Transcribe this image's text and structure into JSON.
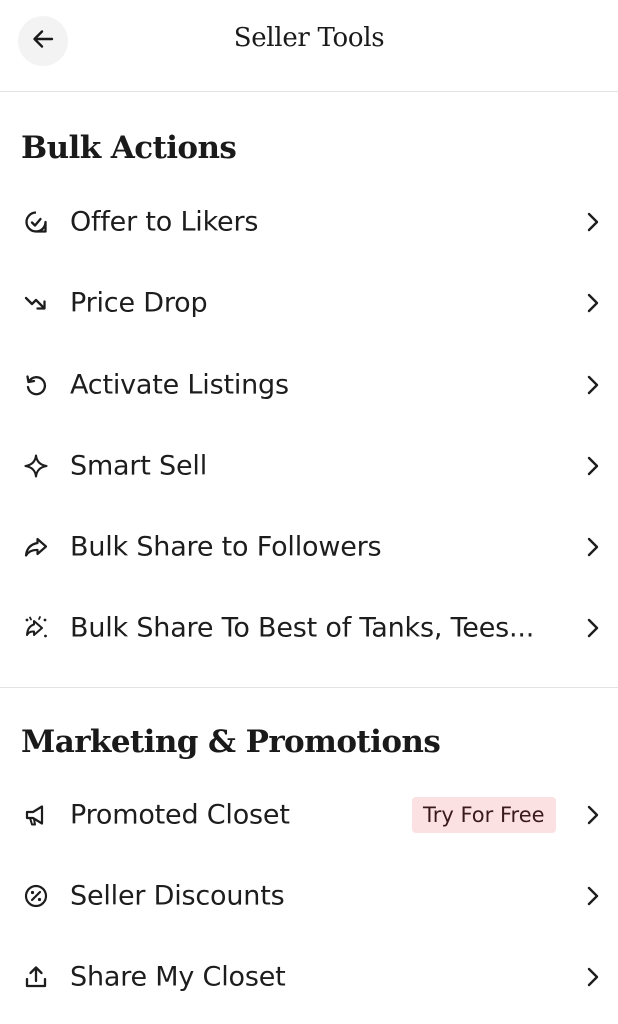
{
  "header": {
    "title": "Seller Tools",
    "back_icon": "arrow-left-icon"
  },
  "sections": [
    {
      "title": "Bulk Actions",
      "items": [
        {
          "label": "Offer to Likers",
          "icon": "offer-tag-icon"
        },
        {
          "label": "Price Drop",
          "icon": "trend-down-icon"
        },
        {
          "label": "Activate Listings",
          "icon": "refresh-icon"
        },
        {
          "label": "Smart Sell",
          "icon": "sparkle-icon"
        },
        {
          "label": "Bulk Share to Followers",
          "icon": "share-arrow-icon"
        },
        {
          "label": "Bulk Share To Best of Tanks, Tees...",
          "icon": "party-share-icon"
        }
      ]
    },
    {
      "title": "Marketing & Promotions",
      "items": [
        {
          "label": "Promoted Closet",
          "icon": "megaphone-icon",
          "badge": "Try For Free"
        },
        {
          "label": "Seller Discounts",
          "icon": "discount-icon"
        },
        {
          "label": "Share My Closet",
          "icon": "upload-icon"
        }
      ]
    }
  ],
  "colors": {
    "badge_bg": "#fbe1e2",
    "divider": "#e3e3e3",
    "text": "#1d1d1d"
  }
}
